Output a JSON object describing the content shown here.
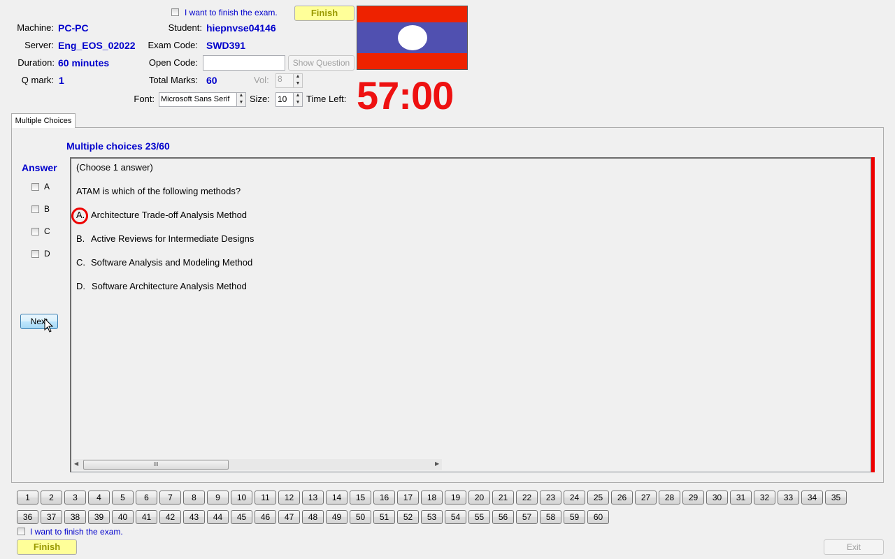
{
  "header": {
    "finish_checkbox_label": "I want to finish the exam.",
    "finish_button": "Finish",
    "machine_label": "Machine:",
    "machine_value": "PC-PC",
    "server_label": "Server:",
    "server_value": "Eng_EOS_02022",
    "duration_label": "Duration:",
    "duration_value": "60 minutes",
    "qmark_label": "Q mark:",
    "qmark_value": "1",
    "student_label": "Student:",
    "student_value": "hiepnvse04146",
    "exam_code_label": "Exam Code:",
    "exam_code_value": "SWD391",
    "open_code_label": "Open Code:",
    "open_code_value": "",
    "show_question_button": "Show Question",
    "total_marks_label": "Total Marks:",
    "total_marks_value": "60",
    "vol_label": "Vol:",
    "vol_value": "8",
    "font_label": "Font:",
    "font_value": "Microsoft Sans Serif",
    "size_label": "Size:",
    "size_value": "10",
    "time_left_label": "Time Left:",
    "timer": "57:00"
  },
  "flag": {
    "stripe_color": "#ee2200",
    "band_color": "#5050b0",
    "circle_color": "#ffffff"
  },
  "tab": {
    "label": "Multiple Choices"
  },
  "main": {
    "title": "Multiple choices 23/60",
    "answer_heading": "Answer",
    "answer_options": [
      "A",
      "B",
      "C",
      "D"
    ],
    "next_button": "Next"
  },
  "question": {
    "instruction": "(Choose 1 answer)",
    "text": "ATAM is which of the following methods?",
    "options": [
      {
        "letter": "A.",
        "text": "Architecture Trade-off Analysis Method"
      },
      {
        "letter": "B.",
        "text": "Active Reviews for Intermediate Designs"
      },
      {
        "letter": "C.",
        "text": "Software Analysis and Modeling Method"
      },
      {
        "letter": "D.",
        "text": "Software Architecture Analysis Method"
      }
    ],
    "scroll_grip": "III"
  },
  "question_numbers_row1": [
    "1",
    "2",
    "3",
    "4",
    "5",
    "6",
    "7",
    "8",
    "9",
    "10",
    "11",
    "12",
    "13",
    "14",
    "15",
    "16",
    "17",
    "18",
    "19",
    "20",
    "21",
    "22",
    "23",
    "24",
    "25",
    "26",
    "27",
    "28",
    "29",
    "30",
    "31",
    "32",
    "33",
    "34",
    "35"
  ],
  "question_numbers_row2": [
    "36",
    "37",
    "38",
    "39",
    "40",
    "41",
    "42",
    "43",
    "44",
    "45",
    "46",
    "47",
    "48",
    "49",
    "50",
    "51",
    "52",
    "53",
    "54",
    "55",
    "56",
    "57",
    "58",
    "59",
    "60"
  ],
  "footer": {
    "finish_checkbox_label": "I want to finish the exam.",
    "finish_button": "Finish",
    "exit_button": "Exit"
  },
  "colors": {
    "value_blue": "#0000cc",
    "timer_red": "#ee1111",
    "finish_yellow": "#ffff99",
    "highlight_red": "#ee0000"
  }
}
